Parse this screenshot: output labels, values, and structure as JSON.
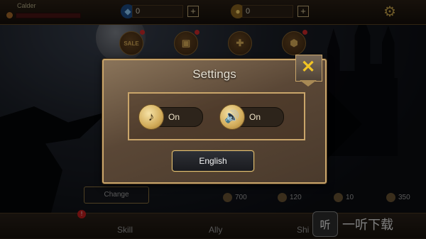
{
  "topbar": {
    "player_name": "Calder",
    "currency_gem": {
      "value": "0",
      "icon": "gem-icon"
    },
    "currency_coin": {
      "value": "0",
      "icon": "coin-icon"
    },
    "plus_label": "+",
    "settings_icon": "gear-icon"
  },
  "menu_icons": [
    {
      "name": "sale-icon",
      "label": "SALE",
      "badge": true
    },
    {
      "name": "chest-icon",
      "label": "",
      "badge": true
    },
    {
      "name": "gift-icon",
      "label": "",
      "badge": false
    },
    {
      "name": "shield-icon",
      "label": "",
      "badge": true
    }
  ],
  "settings_dialog": {
    "title": "Settings",
    "close_label": "✕",
    "music": {
      "icon": "music-note-icon",
      "state": "On"
    },
    "sound": {
      "icon": "speaker-icon",
      "state": "On"
    },
    "language_button": "English"
  },
  "change_button": "Change",
  "stats": [
    {
      "icon": "heart-icon",
      "value": "700"
    },
    {
      "icon": "arrow-up-icon",
      "value": "120"
    },
    {
      "icon": "shield-stat-icon",
      "value": "10"
    },
    {
      "icon": "boot-icon",
      "value": "350"
    }
  ],
  "bottom_tabs": [
    {
      "label": "Skill"
    },
    {
      "label": "Ally"
    },
    {
      "label": "Shi"
    }
  ],
  "notification_badge": "!",
  "watermark": {
    "icon_text": "听",
    "text": "一听下载"
  },
  "colors": {
    "accent_gold": "#c9a56a",
    "close_yellow": "#f2c524",
    "badge_red": "#d22a2a"
  }
}
